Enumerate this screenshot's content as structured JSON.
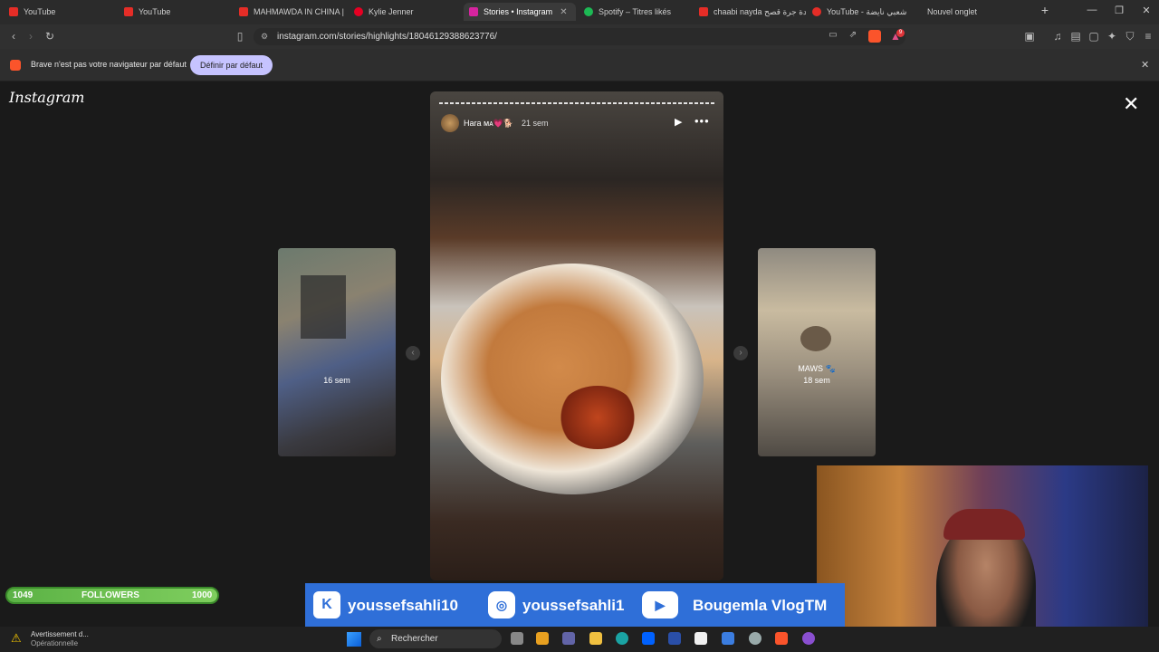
{
  "browser": {
    "tabs": [
      {
        "label": "YouTube",
        "icon": "youtube-icon",
        "color": "#e52d27"
      },
      {
        "label": "YouTube",
        "icon": "youtube-icon",
        "color": "#e52d27"
      },
      {
        "label": "MAHMAWDA IN CHINA | ",
        "icon": "youtube-icon",
        "color": "#e52d27"
      },
      {
        "label": "Kylie Jenner",
        "icon": "pinterest-icon",
        "color": "#e60023"
      },
      {
        "label": "Stories • Instagram",
        "icon": "instagram-icon",
        "color": "#d6249f",
        "active": true
      },
      {
        "label": "Spotify – Titres likés",
        "icon": "spotify-icon",
        "color": "#1db954"
      },
      {
        "label": "chaabi nayda قعدة جرة قصح",
        "icon": "youtube-icon",
        "color": "#e52d27"
      },
      {
        "label": "YouTube - شعبي نايضة",
        "icon": "youtube-music-icon",
        "color": "#e52d27"
      },
      {
        "label": "Nouvel onglet",
        "icon": "",
        "color": ""
      }
    ],
    "new_tab": "+",
    "url": "instagram.com/stories/highlights/18046129388623776/",
    "default_browser_message": "Brave n'est pas votre navigateur par défaut",
    "default_browser_button": "Définir par défaut",
    "shield_count": "9"
  },
  "instagram": {
    "logo": "Instagram",
    "story": {
      "username": "Hara ᴍᴀ💗🐕",
      "time": "21 sem"
    },
    "prev_story": {
      "time": "16 sem"
    },
    "next_story": {
      "title": "MAWS 🐾",
      "time": "18 sem"
    }
  },
  "overlay": {
    "followers_current": "1049",
    "followers_label": "FOLLOWERS",
    "followers_goal": "1000",
    "kick_handle": "youssefsahli10",
    "instagram_handle": "youssefsahli1",
    "youtube_handle": "Bougemla VlogTM"
  },
  "taskbar": {
    "warning_line1": "Avertissement d...",
    "warning_line2": "Opérationnelle",
    "search_placeholder": "Rechercher"
  }
}
